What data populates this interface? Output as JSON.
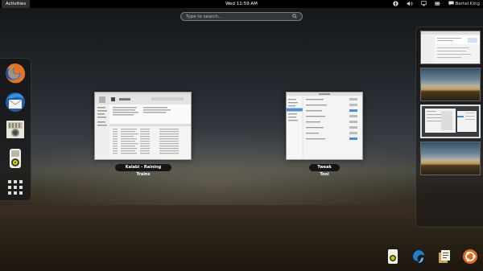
{
  "topbar": {
    "activities_label": "Activities",
    "clock": "Wed 11:59 AM",
    "user_name": "Bertel King"
  },
  "search": {
    "placeholder": "Type to search..."
  },
  "dash": {
    "items": [
      {
        "icon": "firefox-icon"
      },
      {
        "icon": "thunderbird-icon"
      },
      {
        "icon": "screenshot-icon"
      },
      {
        "icon": "rhythmbox-icon"
      },
      {
        "icon": "app-grid-icon"
      }
    ]
  },
  "windows": [
    {
      "caption": "Kalabi - Raining Trains"
    },
    {
      "caption": "Tweak Tool"
    }
  ],
  "message_tray": {
    "items": [
      "rhythmbox-icon",
      "blue-swirl-icon",
      "notes-icon",
      "ubuntu-software-icon"
    ]
  },
  "colors": {
    "topbar": "#000000",
    "selected_workspace_border": "#dddddd"
  }
}
